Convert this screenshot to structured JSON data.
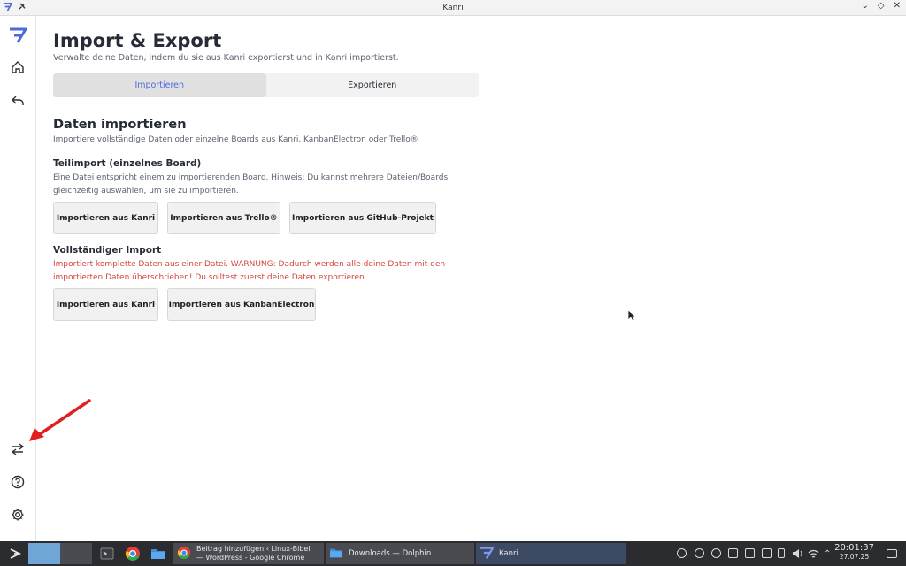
{
  "window": {
    "title": "Kanri"
  },
  "page": {
    "title": "Import & Export",
    "subtitle": "Verwalte deine Daten, indem du sie aus Kanri exportierst und in Kanri importierst.",
    "tabs": [
      {
        "label": "Importieren",
        "active": true
      },
      {
        "label": "Exportieren",
        "active": false
      }
    ]
  },
  "import": {
    "title": "Daten importieren",
    "subtitle": "Importiere vollständige Daten oder einzelne Boards aus Kanri, KanbanElectron oder Trello®",
    "partial": {
      "heading": "Teilimport (einzelnes Board)",
      "description": "Eine Datei entspricht einem zu importierenden Board. Hinweis: Du kannst mehrere Dateien/Boards gleichzeitig auswählen, um sie zu importieren.",
      "buttons": [
        "Importieren aus Kanri",
        "Importieren aus Trello®",
        "Importieren aus GitHub-Projekt"
      ]
    },
    "full": {
      "heading": "Vollständiger Import",
      "warning": "Importiert komplette Daten aus einer Datei. WARNUNG: Dadurch werden alle deine Daten mit den importierten Daten überschrieben! Du solltest zuerst deine Daten exportieren.",
      "buttons": [
        "Importieren aus Kanri",
        "Importieren aus KanbanElectron"
      ]
    }
  },
  "taskbar": {
    "windows": [
      {
        "label": "Beitrag hinzufügen ‹ Linux-Bibel — WordPress - Google Chrome"
      },
      {
        "label": "Downloads — Dolphin"
      },
      {
        "label": "Kanri"
      }
    ],
    "clock": {
      "time": "20:01:37",
      "date": "27.07.25"
    }
  },
  "colors": {
    "accent": "#4e6ad8",
    "warning": "#d6453b",
    "arrow": "#e02020"
  }
}
